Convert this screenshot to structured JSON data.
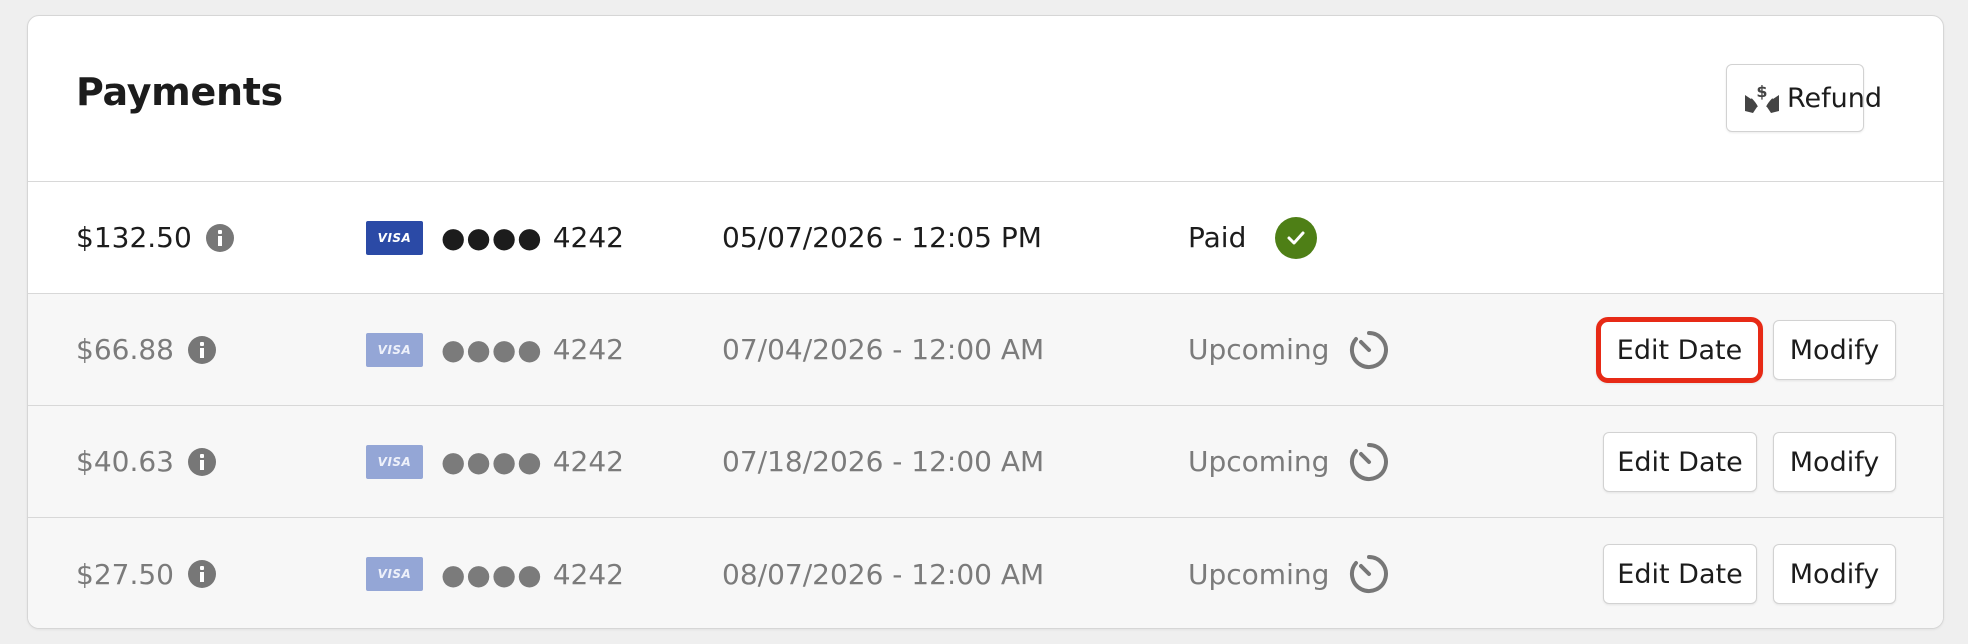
{
  "header": {
    "title": "Payments",
    "refund_label": "Refund"
  },
  "payments": [
    {
      "amount": "$132.50",
      "card_brand": "VISA",
      "card_dots": "●●●●",
      "card_last4": "4242",
      "datetime": "05/07/2026 - 12:05 PM",
      "status": "Paid"
    },
    {
      "amount": "$66.88",
      "card_brand": "VISA",
      "card_dots": "●●●●",
      "card_last4": "4242",
      "datetime": "07/04/2026 - 12:00 AM",
      "status": "Upcoming",
      "edit_label": "Edit Date",
      "modify_label": "Modify"
    },
    {
      "amount": "$40.63",
      "card_brand": "VISA",
      "card_dots": "●●●●",
      "card_last4": "4242",
      "datetime": "07/18/2026 - 12:00 AM",
      "status": "Upcoming",
      "edit_label": "Edit Date",
      "modify_label": "Modify"
    },
    {
      "amount": "$27.50",
      "card_brand": "VISA",
      "card_dots": "●●●●",
      "card_last4": "4242",
      "datetime": "08/07/2026 - 12:00 AM",
      "status": "Upcoming",
      "edit_label": "Edit Date",
      "modify_label": "Modify"
    }
  ],
  "colors": {
    "paid": "#4e7f16",
    "highlight": "#e72a16",
    "visa": "#2b4aa6"
  },
  "icons": {
    "refund": "refund-hands-icon",
    "info": "info-icon",
    "paid": "check-circle-icon",
    "upcoming": "timer-icon"
  }
}
